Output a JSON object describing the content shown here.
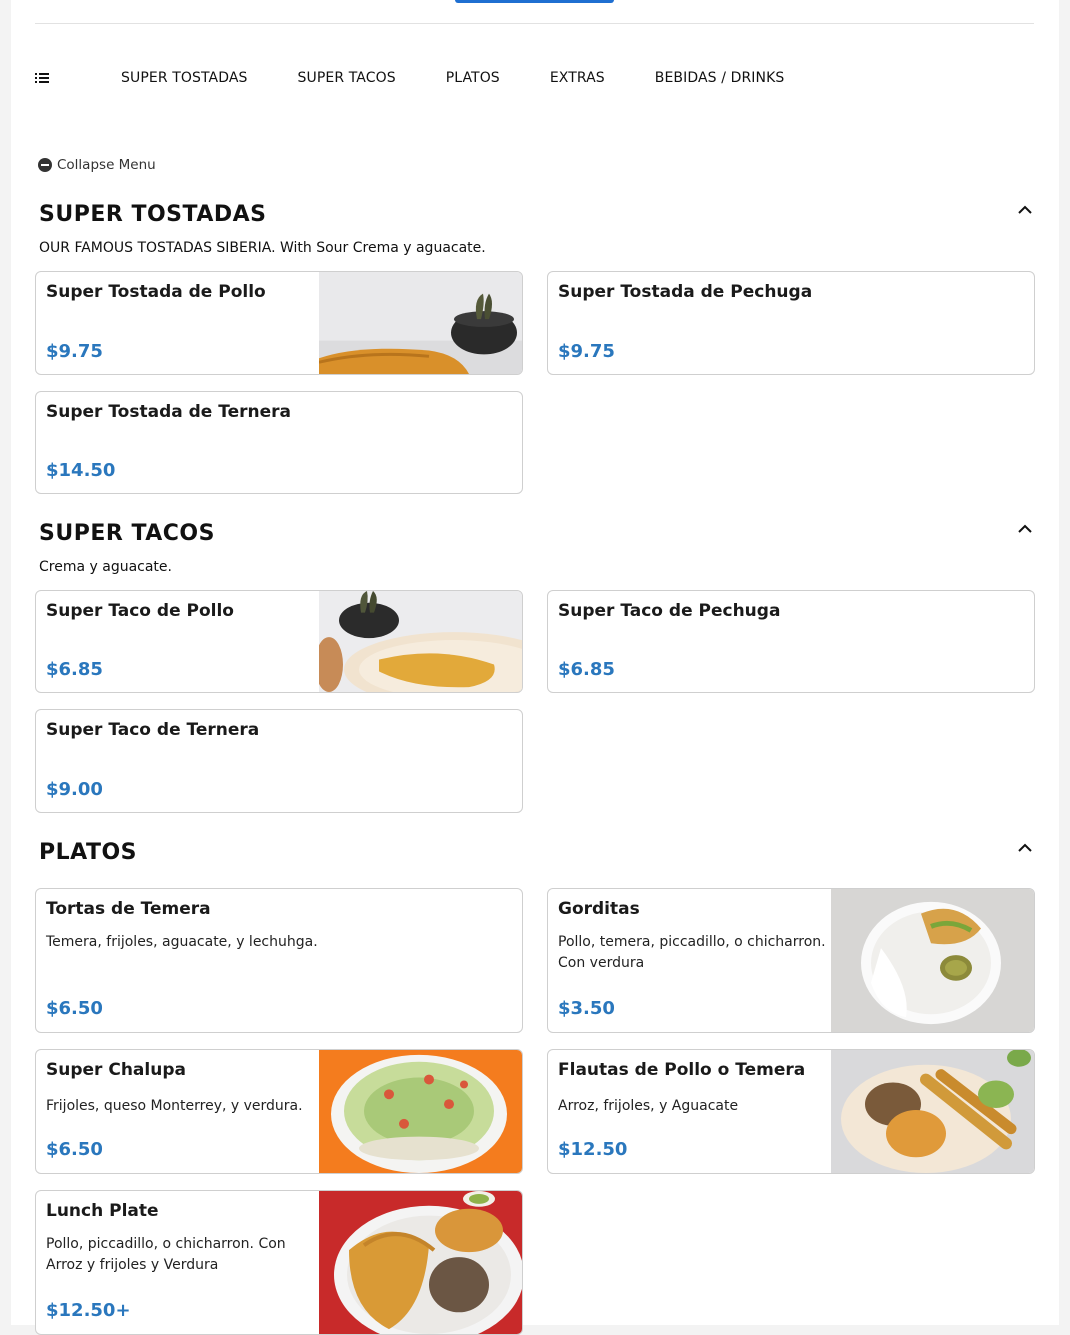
{
  "nav": {
    "items": [
      "SUPER TOSTADAS",
      "SUPER TACOS",
      "PLATOS",
      "EXTRAS",
      "BEBIDAS / DRINKS"
    ]
  },
  "collapse_menu_label": "Collapse Menu",
  "sections": [
    {
      "title": "SUPER TOSTADAS",
      "description": "OUR FAMOUS TOSTADAS SIBERIA. With Sour Crema y aguacate.",
      "items": [
        {
          "name": "Super Tostada de Pollo",
          "price": "$9.75",
          "photo": "tostada-photo"
        },
        {
          "name": "Super Tostada de Pechuga",
          "price": "$9.75"
        },
        {
          "name": "Super Tostada de Ternera",
          "price": "$14.50"
        }
      ]
    },
    {
      "title": "SUPER TACOS",
      "description": "Crema y aguacate.",
      "items": [
        {
          "name": "Super Taco de Pollo",
          "price": "$6.85",
          "photo": "taco-photo"
        },
        {
          "name": "Super Taco de Pechuga",
          "price": "$6.85"
        },
        {
          "name": "Super Taco de Ternera",
          "price": "$9.00"
        }
      ]
    },
    {
      "title": "PLATOS",
      "items": [
        {
          "name": "Tortas de Temera",
          "description": "Temera, frijoles, aguacate, y lechuhga.",
          "price": "$6.50"
        },
        {
          "name": "Gorditas",
          "description": "Pollo, temera, piccadillo, o chicharron. Con verdura",
          "price": "$3.50",
          "photo": "gorditas-photo"
        },
        {
          "name": "Super Chalupa",
          "description": "Frijoles, queso Monterrey, y verdura.",
          "price": "$6.50",
          "photo": "chalupa-photo"
        },
        {
          "name": "Flautas de Pollo o Temera",
          "description": "Arroz, frijoles, y Aguacate",
          "price": "$12.50",
          "photo": "flautas-photo"
        },
        {
          "name": "Lunch Plate",
          "description": "Pollo, piccadillo, o chicharron. Con Arroz y frijoles y Verdura",
          "price": "$12.50+",
          "photo": "lunch-plate-photo"
        }
      ]
    }
  ],
  "colors": {
    "price": "#2a77bd",
    "accent_button": "#1f6fd1",
    "card_border": "#cfcfcf"
  },
  "icons": [
    "list-icon",
    "minus-circle-icon",
    "chevron-up-icon"
  ]
}
